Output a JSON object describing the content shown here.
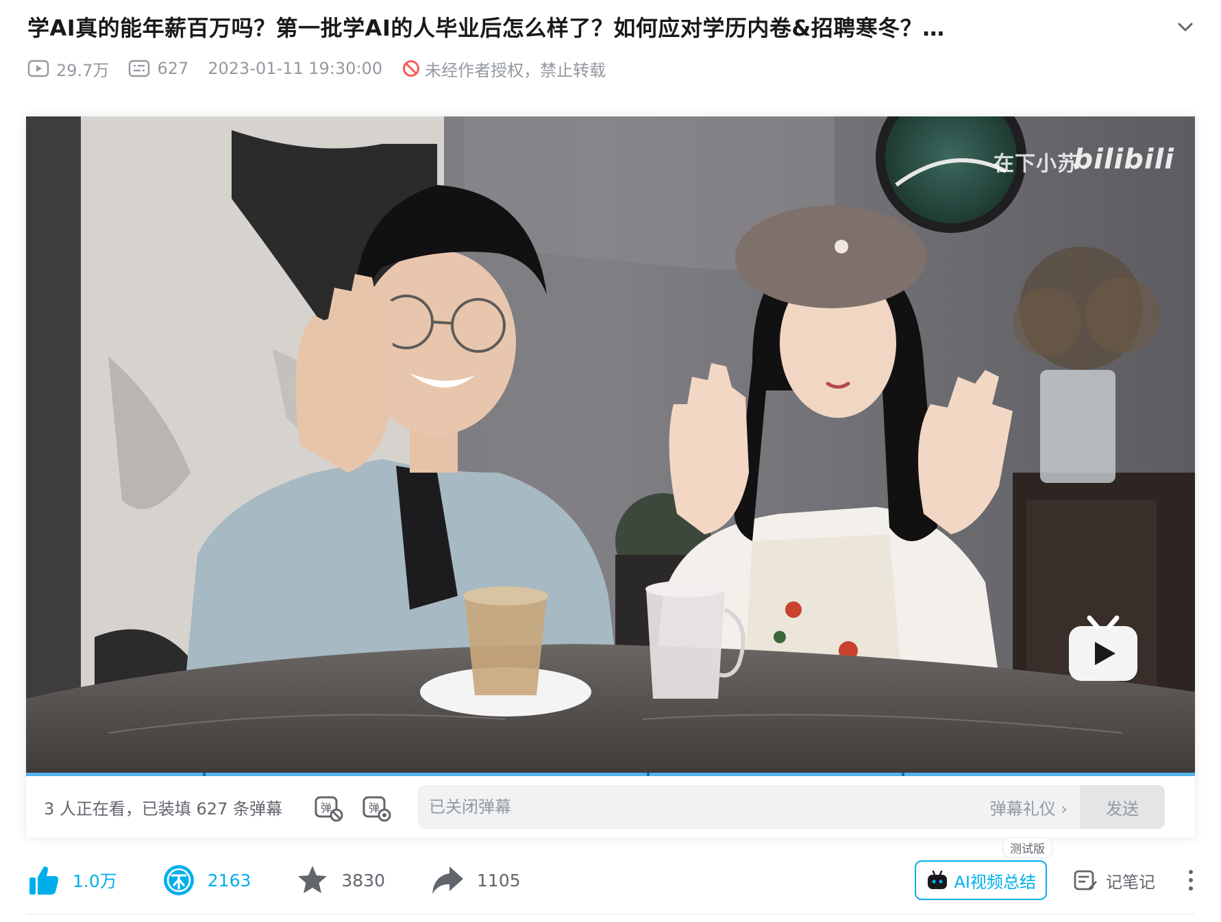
{
  "title": "学AI真的能年薪百万吗？第一批学AI的人毕业后怎么样了？如何应对学历内卷&招聘寒冬？…",
  "meta": {
    "views": "29.7万",
    "danmaku_count": "627",
    "publish_time": "2023-01-11 19:30:00",
    "copyright_notice": "未经作者授权，禁止转载"
  },
  "video": {
    "watermark_author": "在下小苏",
    "watermark_logo": "bilibili"
  },
  "danmaku_bar": {
    "viewer_text": "3 人正在看，已装填 627 条弹幕",
    "input_placeholder": "已关闭弹幕",
    "etiquette_label": "弹幕礼仪 ›",
    "send_label": "发送"
  },
  "actions": {
    "like_count": "1.0万",
    "coin_count": "2163",
    "favorite_count": "3830",
    "share_count": "1105",
    "ai_summary_label": "AI视频总结",
    "beta_badge": "测试版",
    "notes_label": "记笔记"
  },
  "colors": {
    "accent": "#00aeec",
    "text_secondary": "#9499a0",
    "progress": "#53b3ea"
  },
  "icons": [
    "chevron-down-icon",
    "play-count-icon",
    "danmaku-count-icon",
    "no-repost-icon",
    "danmaku-toggle-icon",
    "danmaku-settings-icon",
    "like-icon",
    "coin-icon",
    "star-icon",
    "share-icon",
    "ai-robot-icon",
    "notes-icon",
    "more-icon",
    "tv-play-icon"
  ]
}
